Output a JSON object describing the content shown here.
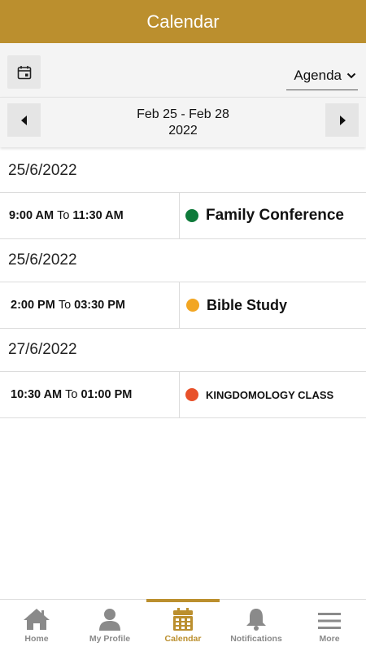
{
  "header": {
    "title": "Calendar"
  },
  "toolbar": {
    "view_selected": "Agenda"
  },
  "range": {
    "line1": "Feb 25 - Feb 28",
    "line2": "2022"
  },
  "agenda": [
    {
      "date": "25/6/2022",
      "start": "9:00 AM",
      "to": "To",
      "end": "11:30 AM",
      "title": "Family Conference",
      "color": "#0e7a3a"
    },
    {
      "date": "25/6/2022",
      "start": "2:00 PM",
      "to": "To",
      "end": "03:30 PM",
      "title": "Bible Study",
      "color": "#f2a623"
    },
    {
      "date": "27/6/2022",
      "start": "10:30 AM",
      "to": "To",
      "end": "01:00 PM",
      "title": "KINGDOMOLOGY CLASS",
      "color": "#e8512a"
    }
  ],
  "tabs": [
    {
      "label": "Home",
      "icon": "home-icon"
    },
    {
      "label": "My Profile",
      "icon": "profile-icon"
    },
    {
      "label": "Calendar",
      "icon": "calendar-icon",
      "active": true
    },
    {
      "label": "Notifications",
      "icon": "bell-icon"
    },
    {
      "label": "More",
      "icon": "menu-icon"
    }
  ],
  "colors": {
    "accent": "#bb8f2e",
    "inactive": "#8a8a8a"
  }
}
